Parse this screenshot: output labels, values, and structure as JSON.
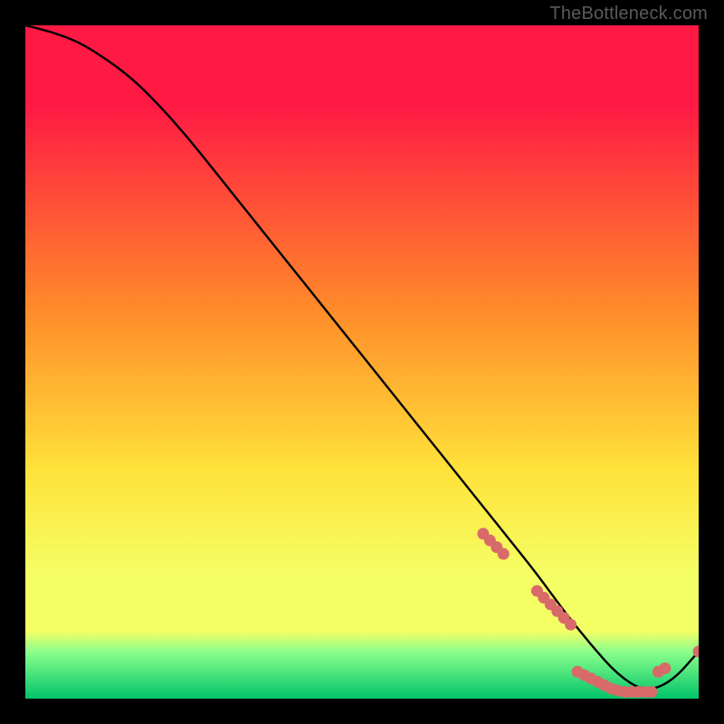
{
  "watermark": "TheBottleneck.com",
  "chart_data": {
    "type": "line",
    "title": "",
    "xlabel": "",
    "ylabel": "",
    "xlim": [
      0,
      100
    ],
    "ylim": [
      0,
      100
    ],
    "series": [
      {
        "name": "curve",
        "x": [
          0,
          4,
          8,
          12,
          16,
          20,
          24,
          28,
          32,
          36,
          40,
          44,
          48,
          52,
          56,
          60,
          64,
          68,
          72,
          76,
          80,
          84,
          88,
          92,
          96,
          100
        ],
        "y": [
          100,
          99,
          97.5,
          95,
          92,
          88,
          83.5,
          78.5,
          73.5,
          68.5,
          63.5,
          58.5,
          53.5,
          48.5,
          43.5,
          38.5,
          33.5,
          28.5,
          23.5,
          18.5,
          13,
          8,
          3.5,
          1,
          2.5,
          7
        ]
      }
    ],
    "markers": {
      "name": "dots",
      "x": [
        68,
        69,
        70,
        71,
        76,
        77,
        78,
        79,
        80,
        81,
        82,
        83,
        84,
        85,
        86,
        87,
        88,
        89,
        90,
        91,
        92,
        93,
        94,
        95,
        100
      ],
      "y": [
        24.5,
        23.5,
        22.5,
        21.5,
        16,
        15,
        14,
        13,
        12,
        11,
        4,
        3.5,
        3,
        2.5,
        2,
        1.5,
        1.2,
        1,
        1,
        1,
        1,
        1,
        4,
        4.5,
        7
      ]
    },
    "gradient_colors": {
      "top": "#ff1a44",
      "mid1": "#ff8a2a",
      "mid2": "#ffe23a",
      "low": "#f4ff66",
      "band": "#8bff8b",
      "bottom": "#00c46a"
    },
    "marker_color": "#d96a6a",
    "curve_color": "#000000"
  }
}
